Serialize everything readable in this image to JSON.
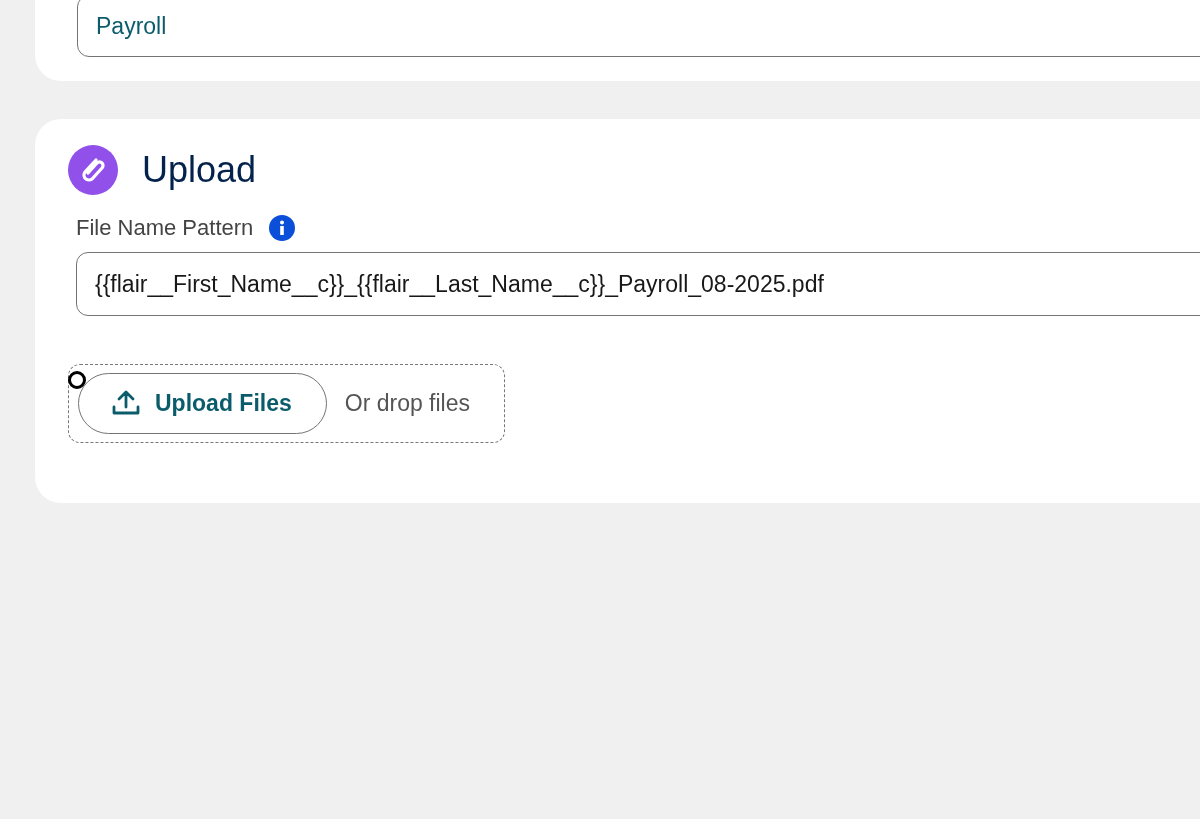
{
  "top_card": {
    "field": {
      "value": "Payroll"
    }
  },
  "upload_card": {
    "title": "Upload",
    "file_name_pattern": {
      "label": "File Name Pattern",
      "value": "{{flair__First_Name__c}}_{{flair__Last_Name__c}}_Payroll_08-2025.pdf"
    },
    "upload_button": "Upload Files",
    "drop_hint": "Or drop files"
  }
}
